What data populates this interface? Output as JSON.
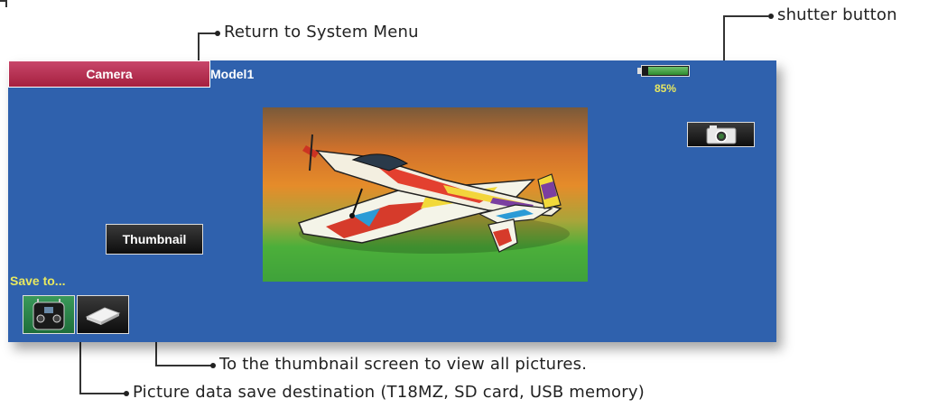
{
  "callouts": {
    "return_menu": "Return to System Menu",
    "shutter": "shutter button",
    "thumbnail": "To the thumbnail screen to view all pictures.",
    "save_dest": "Picture data save destination (T18MZ, SD card, USB memory)"
  },
  "screen": {
    "tab_label": "Camera",
    "model_name": "Model1",
    "battery_percent_text": "85%",
    "battery_level": 0.85,
    "thumbnail_button": "Thumbnail",
    "save_label": "Save to...",
    "save_options": [
      "transmitter-icon",
      "sd-card-icon"
    ],
    "shutter_icon": "camera-icon"
  },
  "colors": {
    "screen_bg": "#2f61ad",
    "tab_bg": "#b52c4f",
    "accent_text": "#e8e860",
    "selected_save": "#2e7d45"
  }
}
